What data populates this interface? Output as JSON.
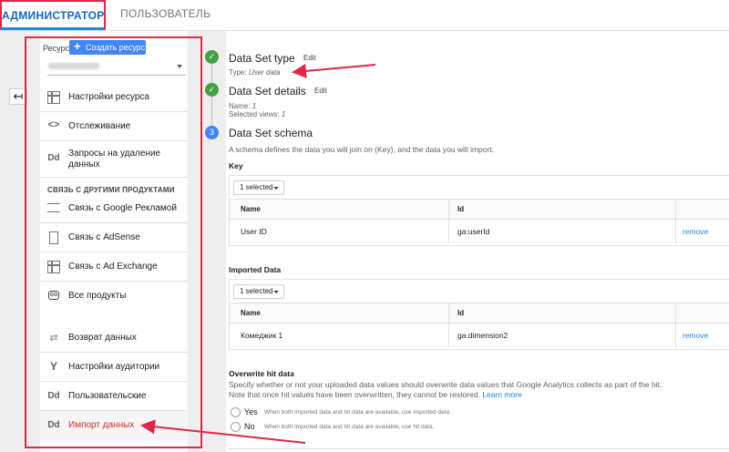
{
  "tabs": {
    "admin": "АДМИНИСТРАТОР",
    "user": "ПОЛЬЗОВАТЕЛЬ"
  },
  "sidebar": {
    "resource_label": "Ресурс",
    "create_button": "Создать ресурс",
    "items_top": [
      {
        "label": "Настройки ресурса",
        "icon": "settings-window-icon"
      },
      {
        "label": "Отслеживание",
        "icon": "code-icon"
      },
      {
        "label": "Запросы на удаление данных",
        "icon": "dd-icon"
      }
    ],
    "section_header": "СВЯЗЬ С ДРУГИМИ ПРОДУКТАМИ",
    "items_links": [
      {
        "label": "Связь с Google Рекламой",
        "icon": "ads-icon"
      },
      {
        "label": "Связь с AdSense",
        "icon": "adsense-icon"
      },
      {
        "label": "Связь с Ad Exchange",
        "icon": "adexchange-icon"
      },
      {
        "label": "Все продукты",
        "icon": "link-icon"
      }
    ],
    "items_bottom": [
      {
        "label": "Возврат данных",
        "icon": "swap-icon"
      },
      {
        "label": "Настройки аудитории",
        "icon": "fork-icon"
      },
      {
        "label": "Пользовательские",
        "icon": "dd-icon"
      },
      {
        "label": "Импорт данных",
        "icon": "dd-icon"
      }
    ]
  },
  "steps": {
    "s1": {
      "title": "Data Set type",
      "edit": "Edit",
      "meta_label": "Type:",
      "meta_value": "User data"
    },
    "s2": {
      "title": "Data Set details",
      "edit": "Edit",
      "name_label": "Name:",
      "name_value": "1",
      "views_label": "Selected views:",
      "views_value": "1"
    },
    "s3": {
      "number": "3",
      "title": "Data Set schema",
      "desc": "A schema defines the data you will join on (Key), and the data you will import."
    }
  },
  "key": {
    "header": "Key",
    "select_label": "1 selected",
    "col_name": "Name",
    "col_id": "Id",
    "row": {
      "name": "User ID",
      "id": "ga:userId",
      "action": "remove"
    }
  },
  "imported": {
    "header": "Imported Data",
    "select_label": "1 selected",
    "col_name": "Name",
    "col_id": "Id",
    "row": {
      "name": "Комеджик 1",
      "id": "ga:dimension2",
      "action": "remove"
    }
  },
  "overwrite": {
    "header": "Overwrite hit data",
    "desc_line1": "Specify whether or not your uploaded data values should overwrite data values that Google Analytics collects as part of the hit.",
    "desc_line2": "Note that once hit values have been overwritten, they cannot be restored.",
    "learn_more": "Learn more",
    "yes_label": "Yes",
    "yes_desc": "When both imported data and hit data are available, use imported data.",
    "no_label": "No",
    "no_desc": "When both imported data and hit data are available, use hit data."
  },
  "colors": {
    "accent": "#1e88e5",
    "annotation": "#e2254a",
    "success": "#43a047",
    "step": "#4285f4"
  }
}
